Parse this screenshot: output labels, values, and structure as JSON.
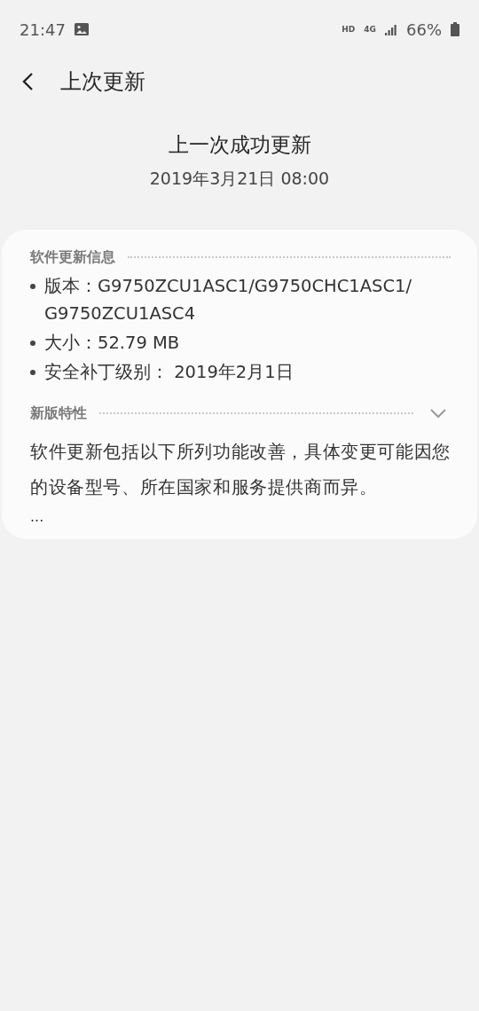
{
  "status_bar": {
    "time": "21:47",
    "network_label": "HD",
    "network_type": "4G",
    "battery": "66%"
  },
  "header": {
    "title": "上次更新"
  },
  "summary": {
    "title": "上一次成功更新",
    "date": "2019年3月21日 08:00"
  },
  "info_section": {
    "title": "软件更新信息",
    "items": [
      "版本：G9750ZCU1ASC1/G9750CHC1ASC1/G9750ZCU1ASC4",
      "大小：52.79 MB",
      "安全补丁级别： 2019年2月1日"
    ]
  },
  "features_section": {
    "title": "新版特性",
    "expanded": false,
    "description": "软件更新包括以下所列功能改善，具体变更可能因您的设备型号、所在国家和服务提供商而异。",
    "more": "..."
  }
}
